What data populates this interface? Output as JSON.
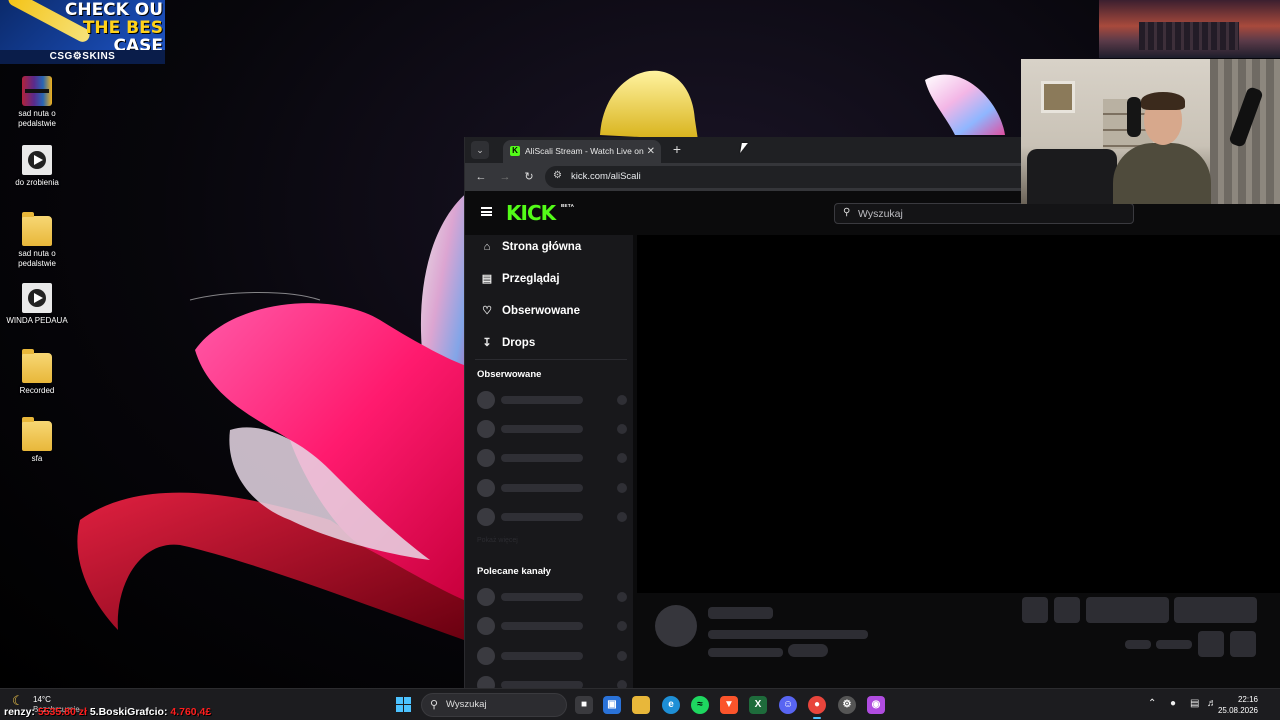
{
  "ad": {
    "lines": [
      "CHECK OU",
      "THE BES",
      "CASE"
    ],
    "brand": "CSG⚙SKINS"
  },
  "desktop_icons": [
    {
      "label": "sad nuta o pedalstwie",
      "icon": "winrar-archive-icon"
    },
    {
      "label": "do zrobienia",
      "icon": "video-file-icon"
    },
    {
      "label": "sad nuta o pedalstwie",
      "icon": "folder-icon"
    },
    {
      "label": "WINDA PEDAUA",
      "icon": "video-file-icon"
    },
    {
      "label": "Recorded",
      "icon": "folder-icon"
    },
    {
      "label": "sfa",
      "icon": "folder-icon"
    }
  ],
  "browser": {
    "tab_title": "AliScali Stream - Watch Live on",
    "tab_close": "✕",
    "new_tab": "+",
    "url": "kick.com/aliScali",
    "back": "←",
    "forward": "→",
    "reload": "↻"
  },
  "kick": {
    "logo": "KICK",
    "beta": "BETA",
    "search_placeholder": "Wyszukaj",
    "nav": [
      {
        "label": "Strona główna",
        "icon": "home-icon"
      },
      {
        "label": "Przeglądaj",
        "icon": "browse-icon"
      },
      {
        "label": "Obserwowane",
        "icon": "heart-icon"
      },
      {
        "label": "Drops",
        "icon": "drops-icon"
      }
    ],
    "following_heading": "Obserwowane",
    "show_more": "Pokaż więcej",
    "recommended_heading": "Polecane kanały"
  },
  "taskbar": {
    "weather_temp": "14°C",
    "weather_cond": "Bezchmurnie",
    "overlay_prefix": "renzy:",
    "overlay_value1": "5535.80 zł",
    "overlay_name2": "5.BoskiGrafcio:",
    "overlay_value2": "4.760,4£",
    "search_placeholder": "Wyszukaj",
    "time": "22:16",
    "date": "25.08.2026"
  },
  "colors": {
    "kick_green": "#53fc18",
    "sidebar_bg": "#18181b",
    "taskbar_bg": "#1c1c1f",
    "windows_blue": "#4cc2ff"
  }
}
